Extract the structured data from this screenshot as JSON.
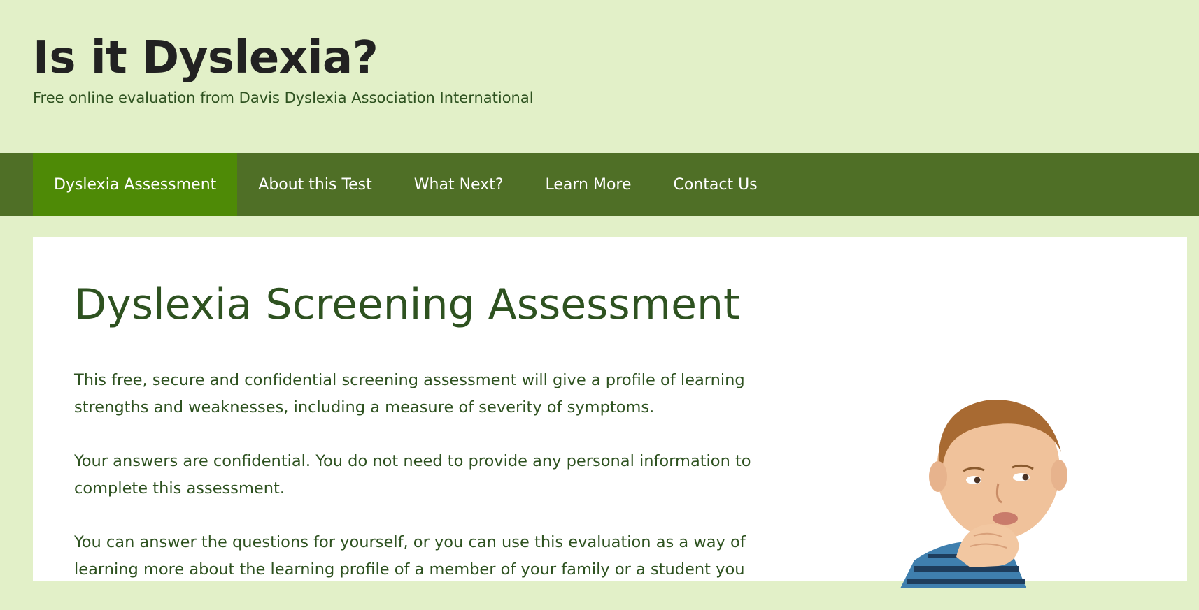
{
  "header": {
    "site_title": "Is it Dyslexia?",
    "tagline": "Free online evaluation from Davis Dyslexia Association International"
  },
  "nav": {
    "items": [
      {
        "label": "Dyslexia Assessment",
        "active": true
      },
      {
        "label": "About this Test",
        "active": false
      },
      {
        "label": "What Next?",
        "active": false
      },
      {
        "label": "Learn More",
        "active": false
      },
      {
        "label": "Contact Us",
        "active": false
      }
    ]
  },
  "main": {
    "title": "Dyslexia Screening Assessment",
    "paragraphs": [
      "This free, secure and confidential screening assessment will give a profile of learning strengths and weaknesses, including a measure of severity of symptoms.",
      "Your answers are confidential. You do not need to provide any personal information to complete this assessment.",
      "You can answer the questions for yourself, or you can use this evaluation as a way of learning more about the learning profile of a member of your family or a student you"
    ]
  },
  "colors": {
    "page_background": "#e2f0c8",
    "nav_background": "#4f6f26",
    "nav_active": "#4e8a06",
    "text_green": "#2e5220"
  }
}
